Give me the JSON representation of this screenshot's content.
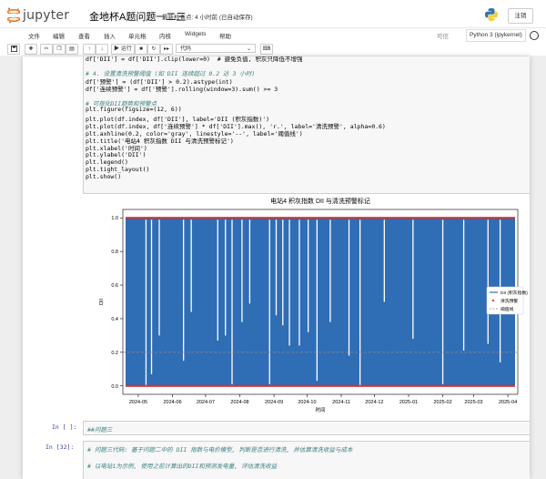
{
  "header": {
    "logo_text": "jupyter",
    "notebook_title": "金地杯A题问题一二三",
    "checkpoint": "最新检查点: 4 小时前   (已自动保存)",
    "logout_label": "注销"
  },
  "menu": {
    "items": [
      "文件",
      "编辑",
      "查看",
      "插入",
      "单元格",
      "内核",
      "Widgets",
      "帮助"
    ],
    "trusted": "可信",
    "kernel": "Python 3 (ipykernel)"
  },
  "toolbar": {
    "run_label": "▶ 运行",
    "cell_type": "代码"
  },
  "code_cell": {
    "lines": [
      {
        "text": "df['DII'] = df['DII'].clip(lower=0)  # 避免负值, 积灰只降低不增强",
        "type": "mixed"
      },
      {
        "text": "",
        "type": "blank"
      },
      {
        "text": "# 4. 设置清洗预警阈值 (如 DII 连续超过 0.2 达 3 小时)",
        "type": "comment"
      },
      {
        "text": "df['预警'] = (df['DII'] > 0.2).astype(int)",
        "type": "code"
      },
      {
        "text": "df['连续预警'] = df['预警'].rolling(window=3).sum() >= 3",
        "type": "code"
      },
      {
        "text": "",
        "type": "blank"
      },
      {
        "text": "# 可视化DII趋势和预警点",
        "type": "comment"
      },
      {
        "text": "plt.figure(figsize=(12, 6))",
        "type": "code"
      },
      {
        "text": "plt.plot(df.index, df['DII'], label='DII (积灰指数)')",
        "type": "code"
      },
      {
        "text": "plt.plot(df.index, df['连续预警'] * df['DII'].max(), 'r.', label='清洗预警', alpha=0.6)",
        "type": "code"
      },
      {
        "text": "plt.axhline(0.2, color='gray', linestyle='--', label='阈值线')",
        "type": "code"
      },
      {
        "text": "plt.title('电站4 积灰指数 DII 与清洗预警标记')",
        "type": "code"
      },
      {
        "text": "plt.xlabel('时间')",
        "type": "code"
      },
      {
        "text": "plt.ylabel('DII')",
        "type": "code"
      },
      {
        "text": "plt.legend()",
        "type": "code"
      },
      {
        "text": "plt.tight_layout()",
        "type": "code"
      },
      {
        "text": "plt.show()",
        "type": "code"
      }
    ]
  },
  "cells_below": [
    {
      "prompt": "In [ ]:",
      "lines": [
        "##问题三"
      ]
    },
    {
      "prompt": "In [32]:",
      "lines": [
        "# 问题三代码: 基于问题二中的 DII 指数与电价模型, 判断是否进行清洗, 并估算清洗收益与成本",
        "",
        "# 以电站1为示例, 使用之前计算出的DII和预测发电量, 评估清洗收益",
        "",
        "# 获取电站1数据"
      ]
    }
  ],
  "chart_data": {
    "type": "line",
    "title": "电站4 积灰指数 DII 与清洗预警标记",
    "xlabel": "时间",
    "ylabel": "DII",
    "x_ticks": [
      "2024-05",
      "2024-06",
      "2024-07",
      "2024-08",
      "2024-09",
      "2024-10",
      "2024-11",
      "2024-12",
      "2025-01",
      "2025-02",
      "2025-03",
      "2025-04"
    ],
    "y_ticks": [
      "0.0",
      "0.2",
      "0.4",
      "0.6",
      "0.8",
      "1.0"
    ],
    "ylim": [
      -0.05,
      1.05
    ],
    "x_range": [
      "2024-04-17",
      "2025-04-10"
    ],
    "threshold": 0.2,
    "warning_level": 1.0,
    "series": [
      {
        "name": "DII (积灰指数)",
        "color": "#2f6db5",
        "style": "dense-line"
      },
      {
        "name": "清洗预警",
        "color": "#d62728",
        "style": "points"
      },
      {
        "name": "阈值线",
        "color": "#888888",
        "style": "dashed"
      }
    ],
    "dips": [
      {
        "date": "2024-05-08",
        "value": 0.0
      },
      {
        "date": "2024-05-13",
        "value": 0.07
      },
      {
        "date": "2024-05-20",
        "value": 0.3
      },
      {
        "date": "2024-06-11",
        "value": 0.15
      },
      {
        "date": "2024-06-18",
        "value": 0.44
      },
      {
        "date": "2024-07-12",
        "value": 0.27
      },
      {
        "date": "2024-07-19",
        "value": 0.3
      },
      {
        "date": "2024-07-25",
        "value": 0.01
      },
      {
        "date": "2024-08-03",
        "value": 0.38
      },
      {
        "date": "2024-08-10",
        "value": 0.49
      },
      {
        "date": "2024-08-28",
        "value": 0.01
      },
      {
        "date": "2024-09-03",
        "value": 0.42
      },
      {
        "date": "2024-09-09",
        "value": 0.36
      },
      {
        "date": "2024-09-15",
        "value": 0.24
      },
      {
        "date": "2024-09-24",
        "value": 0.24
      },
      {
        "date": "2024-10-02",
        "value": 0.32
      },
      {
        "date": "2024-10-10",
        "value": 0.03
      },
      {
        "date": "2024-10-22",
        "value": 0.38
      },
      {
        "date": "2024-11-08",
        "value": 0.18
      },
      {
        "date": "2024-11-18",
        "value": 0.0
      },
      {
        "date": "2024-12-10",
        "value": 0.5
      },
      {
        "date": "2025-01-05",
        "value": 0.28
      },
      {
        "date": "2025-02-01",
        "value": 0.01
      },
      {
        "date": "2025-02-20",
        "value": 0.21
      },
      {
        "date": "2025-03-14",
        "value": 0.25
      },
      {
        "date": "2025-03-25",
        "value": 0.14
      }
    ]
  }
}
